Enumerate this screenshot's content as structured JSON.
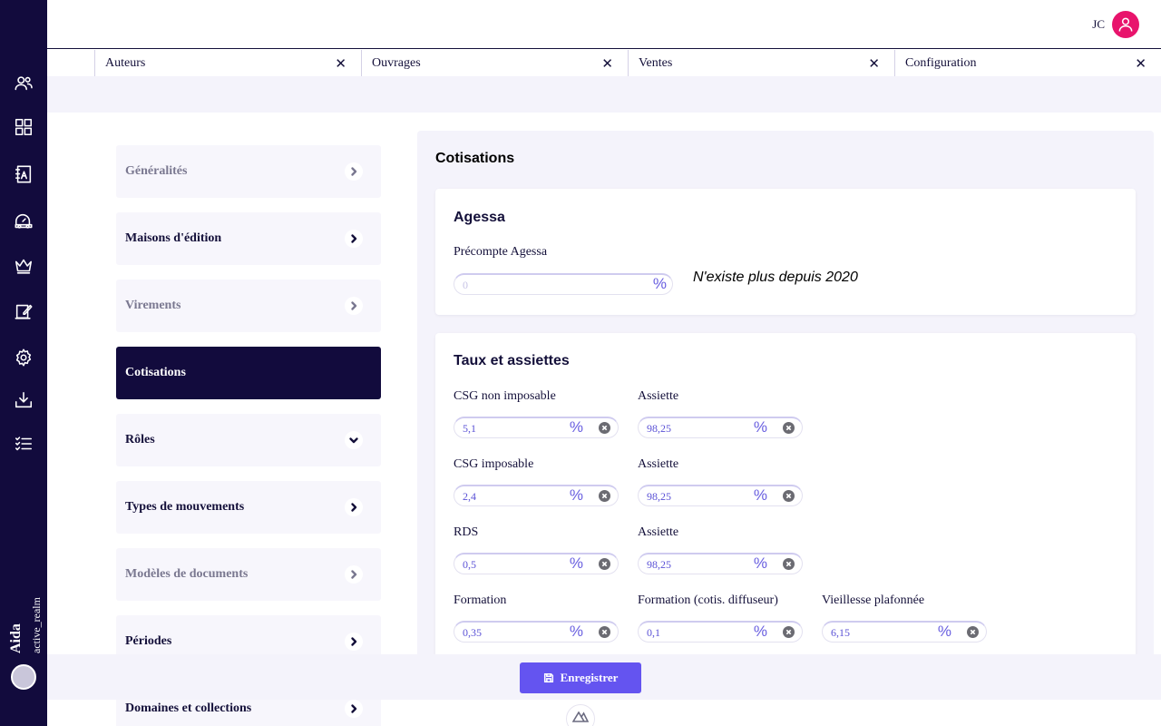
{
  "app": {
    "name": "Aida",
    "realm": "active_realm"
  },
  "header": {
    "user_initials": "JC"
  },
  "tabs": [
    {
      "label": "Auteurs"
    },
    {
      "label": "Ouvrages"
    },
    {
      "label": "Ventes"
    },
    {
      "label": "Configuration"
    }
  ],
  "rail_icons": [
    "users-icon",
    "dashboard-grid-icon",
    "address-book-icon",
    "car-icon",
    "crown-icon",
    "contract-sign-icon",
    "gear-icon",
    "download-icon",
    "checklist-icon"
  ],
  "menu": [
    {
      "label": "Généralités",
      "state": "muted",
      "chevron": "right"
    },
    {
      "label": "Maisons d'édition",
      "state": "normal",
      "chevron": "right"
    },
    {
      "label": "Virements",
      "state": "muted",
      "chevron": "right"
    },
    {
      "label": "Cotisations",
      "state": "active",
      "chevron": "none"
    },
    {
      "label": "Rôles",
      "state": "normal",
      "chevron": "down"
    },
    {
      "label": "Types de mouvements",
      "state": "normal",
      "chevron": "right"
    },
    {
      "label": "Modèles de documents",
      "state": "muted",
      "chevron": "right"
    },
    {
      "label": "Périodes",
      "state": "normal",
      "chevron": "right"
    },
    {
      "label": "Domaines et collections",
      "state": "normal",
      "chevron": "right"
    }
  ],
  "panel": {
    "title": "Cotisations",
    "agessa": {
      "title": "Agessa",
      "field_label": "Précompte Agessa",
      "placeholder": "0",
      "unit": "%",
      "note": "N'existe plus depuis 2020"
    },
    "taux": {
      "title": "Taux et assiettes",
      "rows": [
        [
          {
            "label": "CSG non imposable",
            "value": "5,1"
          },
          {
            "label": "Assiette",
            "value": "98,25"
          }
        ],
        [
          {
            "label": "CSG imposable",
            "value": "2,4"
          },
          {
            "label": "Assiette",
            "value": "98,25"
          }
        ],
        [
          {
            "label": "RDS",
            "value": "0,5"
          },
          {
            "label": "Assiette",
            "value": "98,25"
          }
        ],
        [
          {
            "label": "Formation",
            "value": "0,35"
          },
          {
            "label": "Formation (cotis. diffuseur)",
            "value": "0,1"
          },
          {
            "label": "Vieillesse plafonnée",
            "value": "6,15"
          }
        ]
      ],
      "unit": "%"
    }
  },
  "save_button": {
    "label": "Enregistrer"
  },
  "colors": {
    "rail": "#120b3d",
    "accent": "#6454f0",
    "avatar": "#e8146c"
  }
}
